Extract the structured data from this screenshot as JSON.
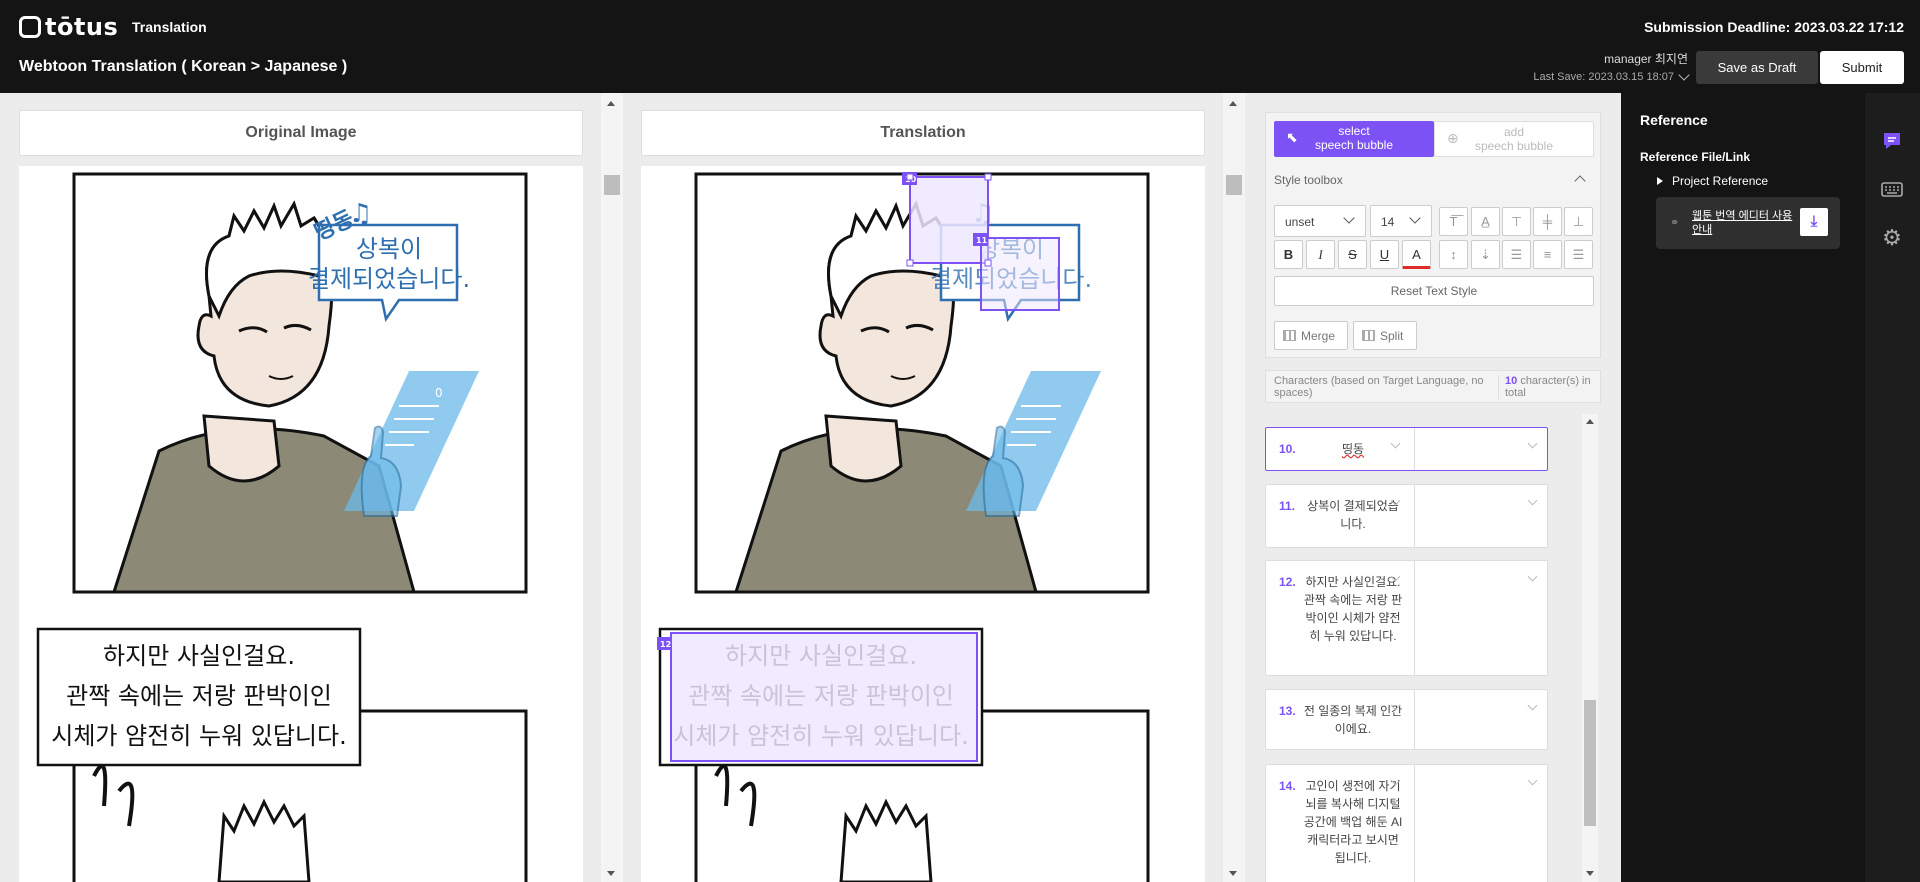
{
  "header": {
    "logo_text": "tōtus",
    "nav_label": "Translation",
    "project_title": "Webtoon Translation ( Korean > Japanese )",
    "deadline": "Submission Deadline: 2023.03.22 17:12",
    "manager": "manager 최지연",
    "last_save": "Last Save: 2023.03.15 18:07",
    "save_draft_label": "Save as Draft",
    "submit_label": "Submit"
  },
  "panels": {
    "original_title": "Original Image",
    "translation_title": "Translation"
  },
  "comic": {
    "sfx": "띵동",
    "bubble1": [
      "상복이",
      "결제되었습니다."
    ],
    "caption": [
      "하지만 사실인걸요.",
      "관짝 속에는 저랑 판박이인",
      "시체가 얌전히 누워 있답니다."
    ],
    "phone_number": "0",
    "box_labels": [
      "10",
      "11",
      "12"
    ]
  },
  "tools": {
    "select_mode": [
      "select",
      "speech bubble"
    ],
    "add_mode": [
      "add",
      "speech bubble"
    ],
    "style_toolbox": "Style toolbox",
    "font_family": "unset",
    "font_size": "14",
    "reset_label": "Reset Text Style",
    "merge_label": "Merge",
    "split_label": "Split"
  },
  "chars": {
    "label": "Characters (based on Target Language, no spaces)",
    "count": "10",
    "count_suffix": "character(s) in total"
  },
  "segments": [
    {
      "num": "10.",
      "source": "띵동",
      "target": ""
    },
    {
      "num": "11.",
      "source": "상복이 결제되었습니다.",
      "target": ""
    },
    {
      "num": "12.",
      "source": "하지만 사실인걸요. 관짝 속에는 저랑 판박이인 시체가 얌전히 누워 있답니다.",
      "target": ""
    },
    {
      "num": "13.",
      "source": "전 일종의 복제 인간이에요.",
      "target": ""
    },
    {
      "num": "14.",
      "source": "고인이 생전에 자기 뇌를 복사해 디지털 공간에 백업 해둔 AI 캐릭터라고 보시면 됩니다.",
      "target": ""
    }
  ],
  "reference": {
    "title": "Reference",
    "file_link": "Reference File/Link",
    "project_reference": "Project Reference",
    "link_text": "웹툰 번역 에디터 사용 안내"
  },
  "colors": {
    "accent": "#7d52f4",
    "bubble_blue": "#2f6fb0",
    "dark": "#141414"
  },
  "icons": [
    "comment-icon",
    "keyboard-icon",
    "gear-icon",
    "download-icon",
    "link-icon",
    "cursor-icon"
  ]
}
